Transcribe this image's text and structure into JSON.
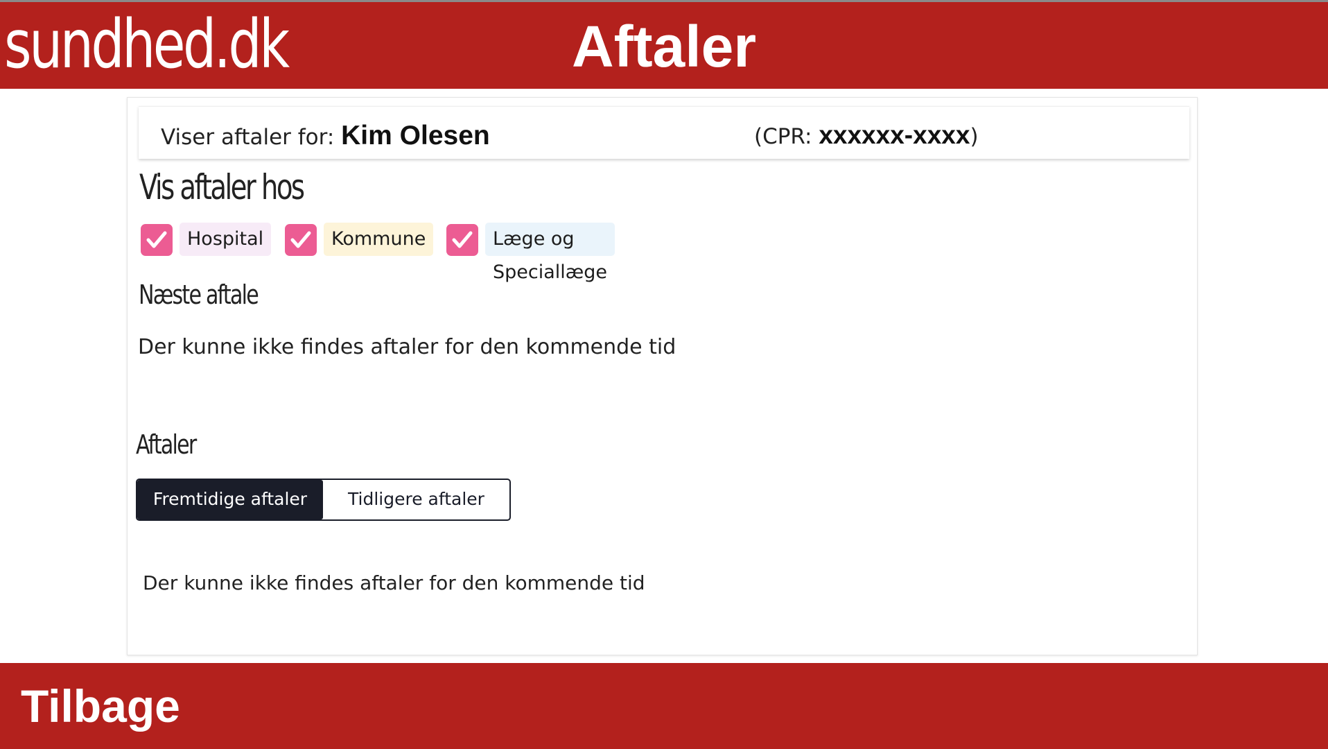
{
  "header": {
    "logo_text": "sundhed.dk",
    "title": "Aftaler"
  },
  "patient": {
    "label": "Viser aftaler for: ",
    "name": "Kim Olesen",
    "cpr_prefix": "(CPR: ",
    "cpr_value": "xxxxxx-xxxx",
    "cpr_suffix": ")"
  },
  "filter_section": {
    "title": "Vis aftaler hos",
    "filters": [
      {
        "label": "Hospital",
        "checked": true,
        "chip_color": "#f7ebf7"
      },
      {
        "label": "Kommune",
        "checked": true,
        "chip_color": "#fdf4d9"
      },
      {
        "label": "Læge og Speciallæge",
        "checked": true,
        "chip_color": "#eaf4fb"
      }
    ],
    "checkbox_color": "#ec5c93"
  },
  "next_appointment": {
    "title": "Næste aftale",
    "empty_message": "Der kunne ikke findes aftaler for den kommende tid"
  },
  "appointments": {
    "title": "Aftaler",
    "tabs": [
      {
        "label": "Fremtidige aftaler",
        "active": true
      },
      {
        "label": "Tidligere aftaler",
        "active": false
      }
    ],
    "empty_message": "Der kunne ikke findes aftaler for den kommende tid"
  },
  "footer": {
    "back_label": "Tilbage"
  },
  "colors": {
    "brand_red": "#b3211d",
    "toggle_dark": "#1a1d29"
  }
}
